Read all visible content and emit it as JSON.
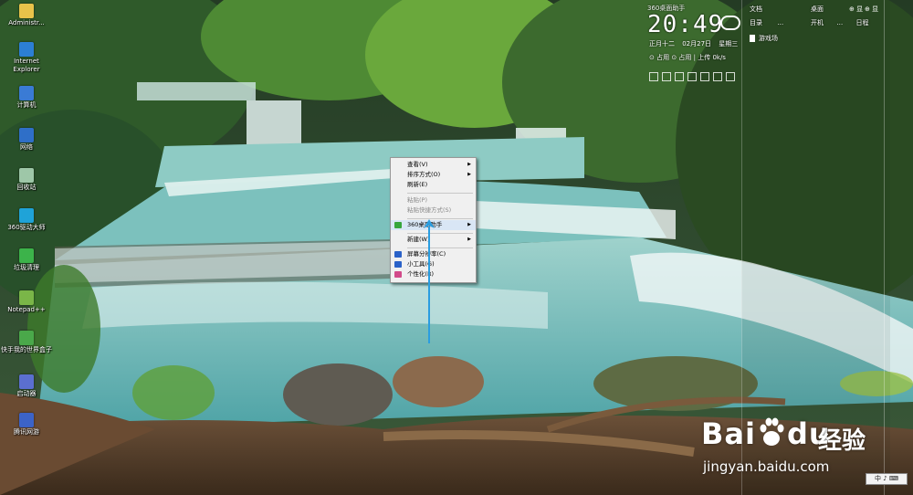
{
  "desktop": {
    "icons": [
      {
        "label": "Administr...",
        "color": "#e8c34a"
      },
      {
        "label": "Internet Explorer",
        "color": "#2c7fd4"
      },
      {
        "label": "计算机",
        "color": "#3a7bd5"
      },
      {
        "label": "网络",
        "color": "#2f6fc8"
      },
      {
        "label": "回收站",
        "color": "#9ec7a8"
      },
      {
        "label": "360驱动大师",
        "color": "#1fa3d8"
      },
      {
        "label": "垃圾清理",
        "color": "#3cb34a"
      },
      {
        "label": "Notepad++",
        "color": "#7ab648"
      },
      {
        "label": "快手我的世界盒子",
        "color": "#4aa84a"
      },
      {
        "label": "启动器",
        "color": "#5b6fd0"
      },
      {
        "label": "腾讯网游",
        "color": "#3c63c7"
      }
    ]
  },
  "widget": {
    "title": "360桌面助手",
    "time": "20:49",
    "date_line": "正月十二 02月27日 星期三",
    "row": "⊙ 占用 ⊙ 占用 | 上传 0k/s",
    "accent": "#ffffff"
  },
  "fence": {
    "title": "文档",
    "toggle": "⊕ 显",
    "tabs": "目录 …",
    "file": "游戏场",
    "title2": "桌面",
    "toggle2": "⊕ 显",
    "tabs2": "开机 … 日程"
  },
  "context_menu": {
    "items": [
      {
        "label": "查看(V)",
        "arrow": true,
        "disabled": false,
        "icon": null
      },
      {
        "label": "排序方式(O)",
        "arrow": true,
        "disabled": false,
        "icon": null
      },
      {
        "label": "刷新(E)",
        "arrow": false,
        "disabled": false,
        "icon": null
      },
      {
        "label": "粘贴(P)",
        "arrow": false,
        "disabled": true,
        "icon": null
      },
      {
        "label": "粘贴快捷方式(S)",
        "arrow": false,
        "disabled": true,
        "icon": null
      },
      {
        "label": "360桌面助手",
        "arrow": true,
        "disabled": false,
        "icon": "#37a63c"
      },
      {
        "label": "新建(W)",
        "arrow": true,
        "disabled": false,
        "icon": null
      },
      {
        "label": "屏幕分辨率(C)",
        "arrow": false,
        "disabled": false,
        "icon": "#2b62c8"
      },
      {
        "label": "小工具(G)",
        "arrow": false,
        "disabled": false,
        "icon": "#2b62c8"
      },
      {
        "label": "个性化(R)",
        "arrow": false,
        "disabled": false,
        "icon": "#d24a8a"
      }
    ],
    "hover_index": 5
  },
  "annotation": {
    "color": "#2a9de0"
  },
  "watermark": {
    "logo": "Bai",
    "logo_suffix": "du",
    "cn": "经验",
    "url": "jingyan.baidu.com"
  },
  "ime": {
    "label": "中 ♪ ⌨"
  }
}
